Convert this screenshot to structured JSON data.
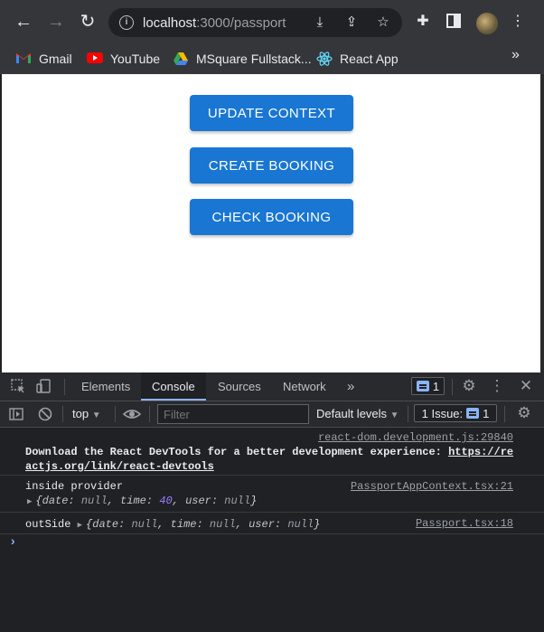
{
  "browser": {
    "url_host": "localhost",
    "url_path": ":3000/passport",
    "bookmarks": [
      {
        "label": "Gmail",
        "icon": "gmail-icon"
      },
      {
        "label": "YouTube",
        "icon": "youtube-icon"
      },
      {
        "label": "MSquare Fullstack...",
        "icon": "drive-icon"
      },
      {
        "label": "React App",
        "icon": "react-icon"
      }
    ],
    "bookmarks_more": "»"
  },
  "page": {
    "buttons": [
      "UPDATE CONTEXT",
      "CREATE BOOKING",
      "CHECK BOOKING"
    ],
    "button_color": "#1976d2"
  },
  "devtools": {
    "tabs": [
      "Elements",
      "Console",
      "Sources",
      "Network"
    ],
    "active_tab": "Console",
    "more_tabs": "»",
    "message_count": "1",
    "context": "top",
    "filter_placeholder": "Filter",
    "levels": "Default levels",
    "issues_label": "1 Issue:",
    "issues_count": "1"
  },
  "console": {
    "devtools_hint": {
      "source": "react-dom.development.js:29840",
      "line1_prefix": "Download the React DevTools for a better development experience: ",
      "line1_link": "https://re",
      "line2_link": "actjs.org/link/react-devtools"
    },
    "inside_log": {
      "text": "inside provider",
      "source": "PassportAppContext.tsx:21",
      "obj_open": "{",
      "date_key": "date: ",
      "date_val": "null",
      "time_key": ", time: ",
      "time_val": "40",
      "user_key": ", user: ",
      "user_val": "null",
      "obj_close": "}"
    },
    "outside_log": {
      "text": "outSide",
      "source": "Passport.tsx:18",
      "obj_open": "{",
      "date_key": "date: ",
      "date_val": "null",
      "time_key": ", time: ",
      "time_val": "null",
      "user_key": ", user: ",
      "user_val": "null",
      "obj_close": "}"
    },
    "prompt": "›"
  }
}
